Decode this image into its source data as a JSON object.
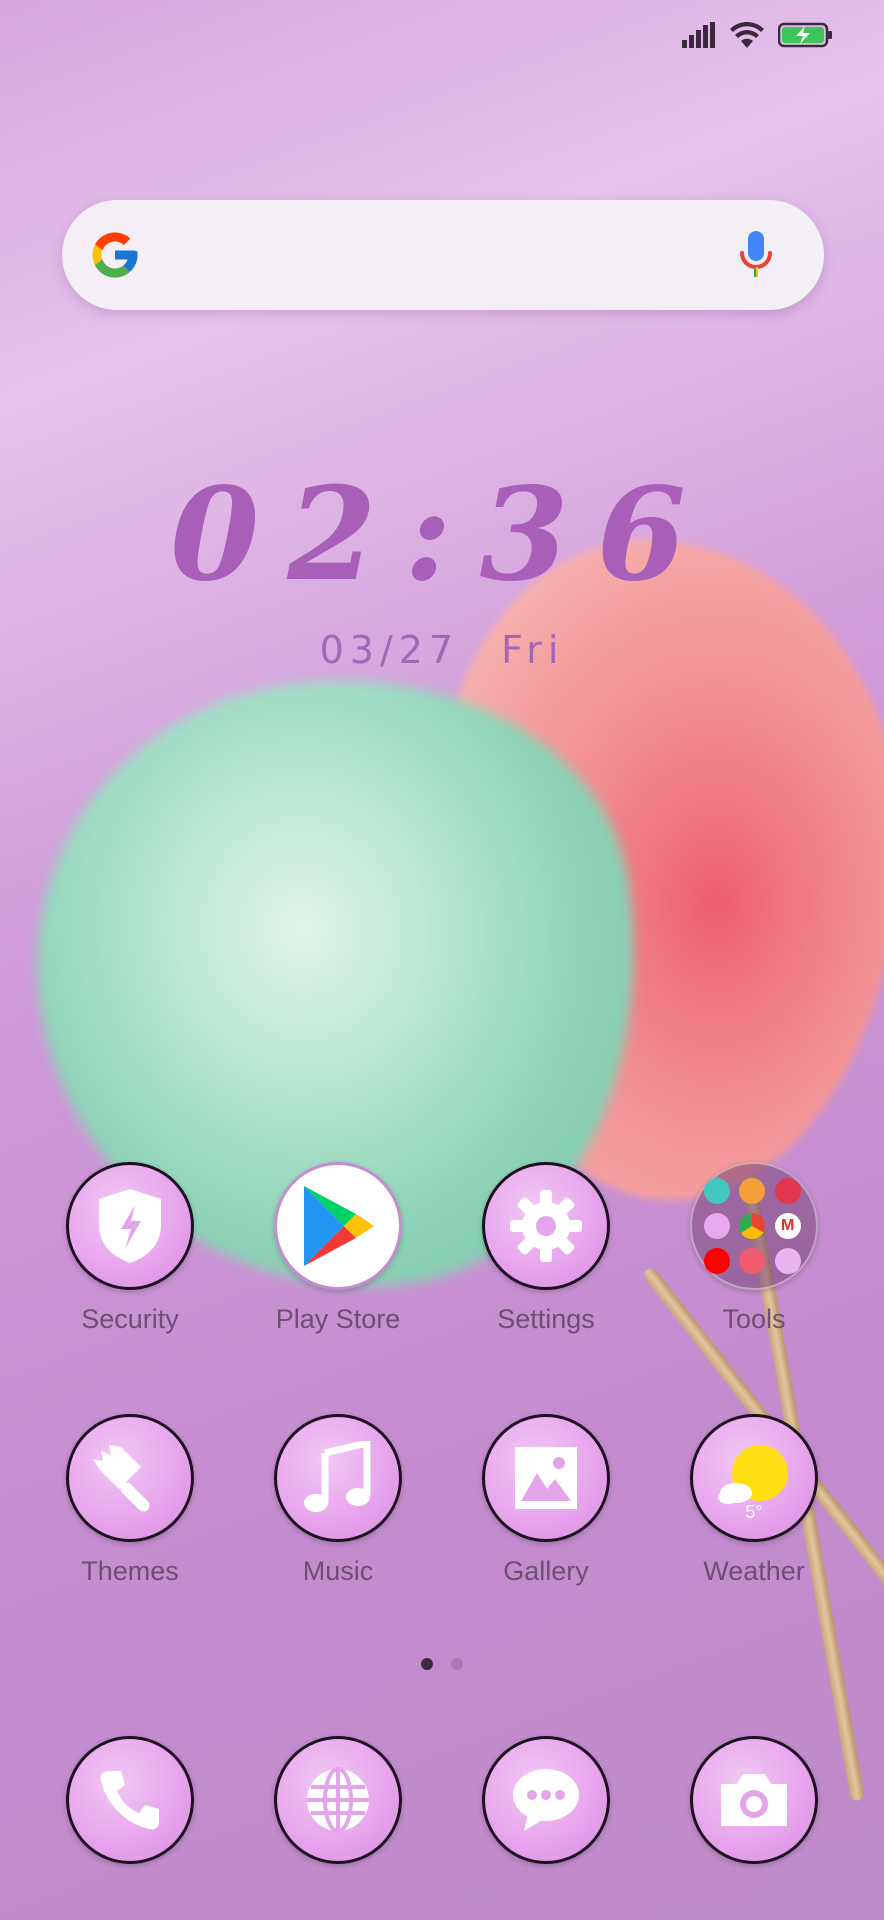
{
  "status_bar": {
    "signal_icon": "cellular-signal-icon",
    "wifi_icon": "wifi-icon",
    "battery_icon": "battery-charging-icon",
    "battery_color": "#3cc65a"
  },
  "search": {
    "logo": "google-logo",
    "mic_icon": "microphone-icon"
  },
  "clock": {
    "time": "02:36",
    "date": "03/27",
    "weekday": "Fri",
    "color": "#a85fb8"
  },
  "apps": {
    "row1": [
      {
        "label": "Security",
        "icon": "shield-lightning-icon"
      },
      {
        "label": "Play Store",
        "icon": "play-store-icon"
      },
      {
        "label": "Settings",
        "icon": "gear-icon"
      },
      {
        "label": "Tools",
        "icon": "folder-icon"
      }
    ],
    "row2": [
      {
        "label": "Themes",
        "icon": "paintbrush-icon"
      },
      {
        "label": "Music",
        "icon": "music-note-icon"
      },
      {
        "label": "Gallery",
        "icon": "picture-icon"
      },
      {
        "label": "Weather",
        "icon": "sun-cloud-icon",
        "temperature": "5°"
      }
    ]
  },
  "page_indicator": {
    "pages": 2,
    "current": 1
  },
  "dock": [
    {
      "icon": "phone-icon"
    },
    {
      "icon": "globe-icon"
    },
    {
      "icon": "message-icon"
    },
    {
      "icon": "camera-icon"
    }
  ]
}
